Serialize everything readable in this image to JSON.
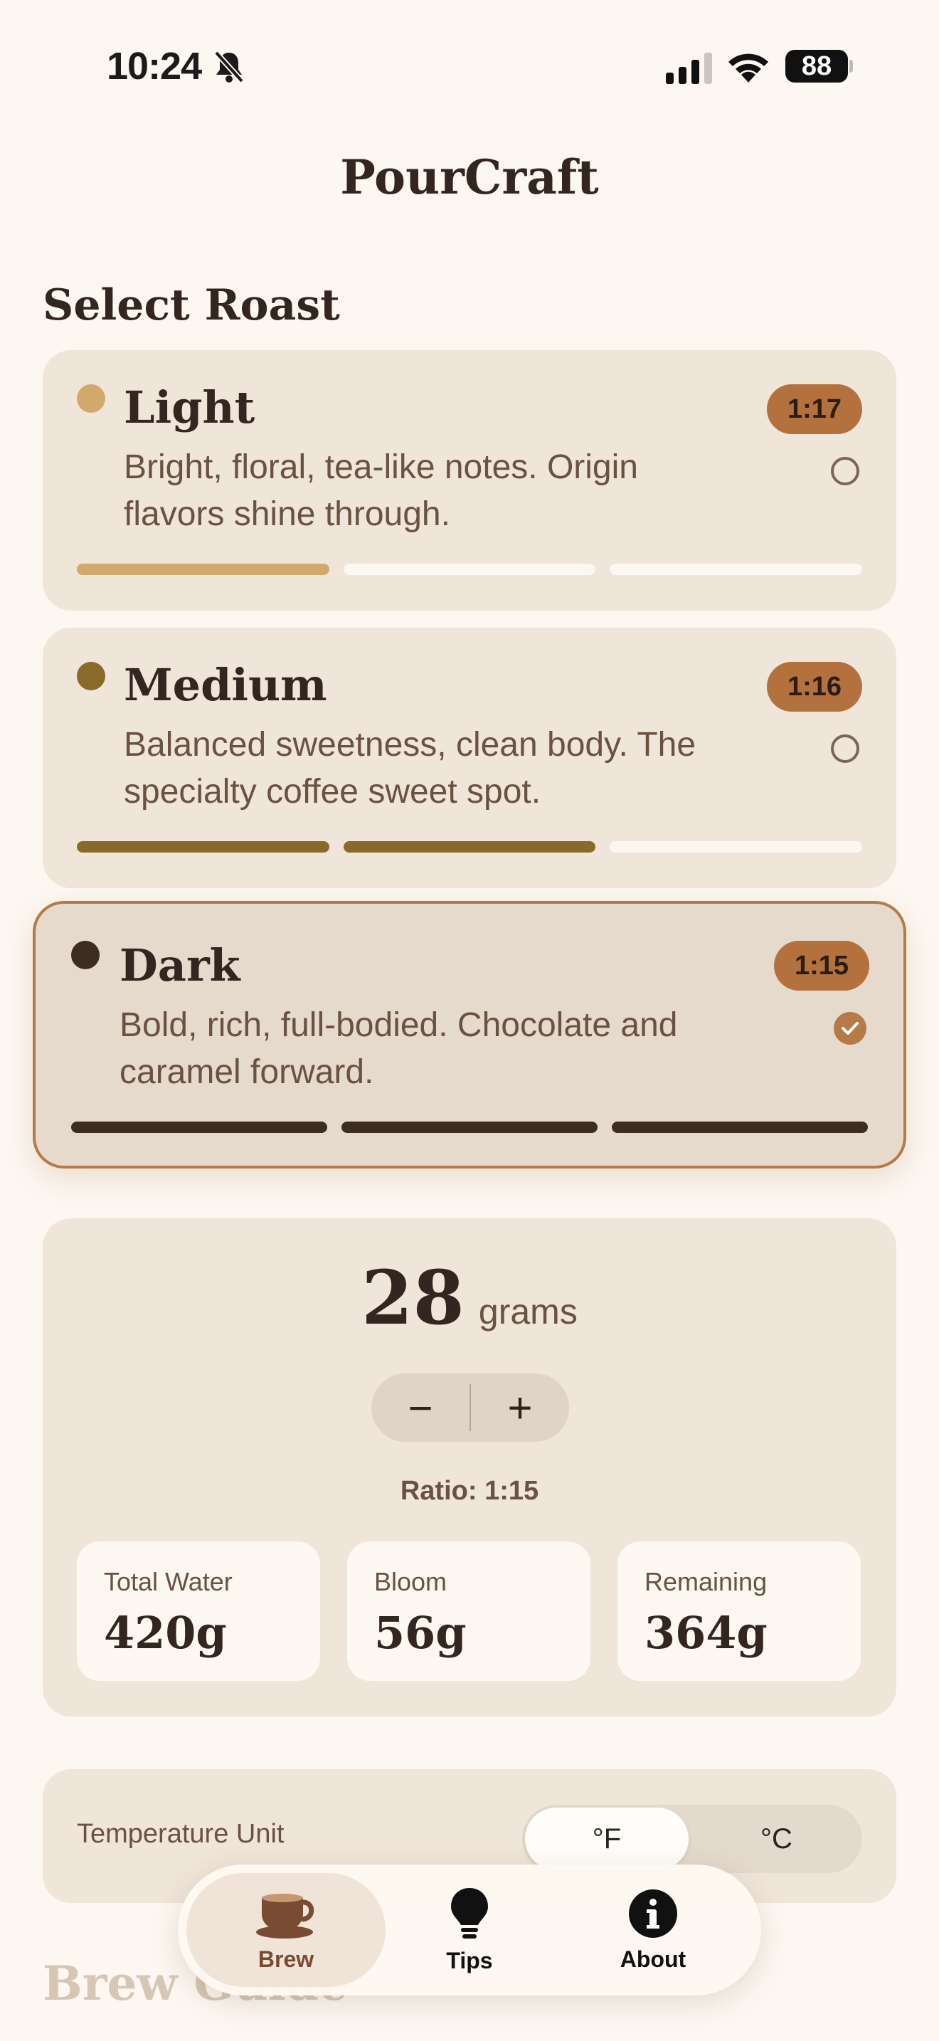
{
  "status": {
    "time": "10:24",
    "battery": "88"
  },
  "app": {
    "title": "PourCraft"
  },
  "section": {
    "title": "Select Roast",
    "next_title": "Brew Guide"
  },
  "roasts": [
    {
      "name": "Light",
      "desc": "Bright, floral, tea-like notes. Origin flavors shine through.",
      "ratio": "1:17",
      "level": 1,
      "color": "#D2A96A",
      "selected": false
    },
    {
      "name": "Medium",
      "desc": "Balanced sweetness, clean body. The specialty coffee sweet spot.",
      "ratio": "1:16",
      "level": 2,
      "color": "#8A6A28",
      "selected": false
    },
    {
      "name": "Dark",
      "desc": "Bold, rich, full-bodied. Chocolate and caramel forward.",
      "ratio": "1:15",
      "level": 3,
      "color": "#3D2C22",
      "selected": true
    }
  ],
  "dose": {
    "value": "28",
    "unit": "grams",
    "minus": "−",
    "plus": "+",
    "ratio_label": "Ratio: 1:15"
  },
  "stats": [
    {
      "label": "Total Water",
      "value": "420g"
    },
    {
      "label": "Bloom",
      "value": "56g"
    },
    {
      "label": "Remaining",
      "value": "364g"
    }
  ],
  "temperature": {
    "label": "Temperature Unit",
    "options": [
      "°F",
      "°C"
    ],
    "selected": "°F"
  },
  "tabs": [
    {
      "label": "Brew",
      "icon": "coffee-cup-icon",
      "active": true
    },
    {
      "label": "Tips",
      "icon": "lightbulb-icon",
      "active": false
    },
    {
      "label": "About",
      "icon": "info-icon",
      "active": false
    }
  ],
  "colors": {
    "accent": "#B2713D",
    "background": "#FCF7F1",
    "card": "#EFE5D8"
  }
}
